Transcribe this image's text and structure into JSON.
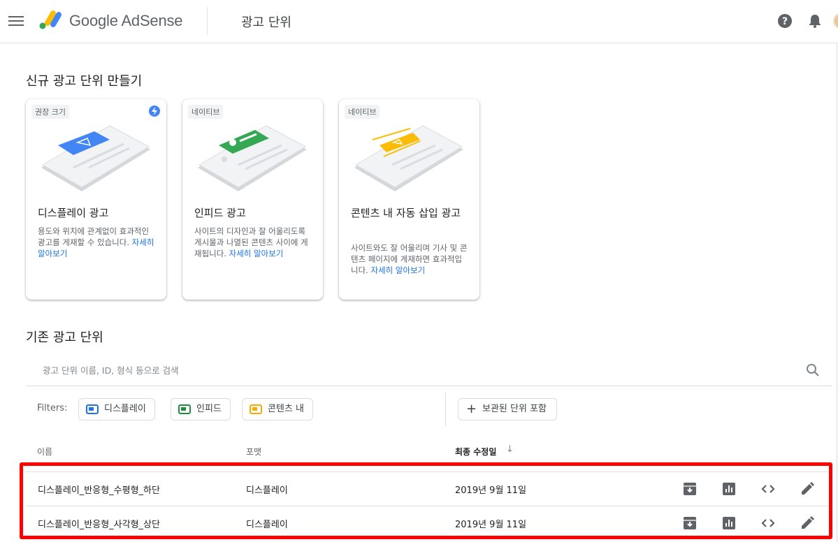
{
  "header": {
    "brand": "Google AdSense",
    "page_title": "광고 단위"
  },
  "create_section": {
    "title": "신규 광고 단위 만들기",
    "cards": [
      {
        "chip": "권장 크기",
        "title": "디스플레이 광고",
        "desc": "용도와 위치에 관계없이 효과적인 광고를 게재할 수 있습니다.",
        "link": "자세히 알아보기",
        "color": "#4285f4"
      },
      {
        "chip": "네이티브",
        "title": "인피드 광고",
        "desc": "사이트의 디자인과 잘 어울리도록 게시물과 나열된 콘텐츠 사이에 게재됩니다.",
        "link": "자세히 알아보기",
        "color": "#34a853"
      },
      {
        "chip": "네이티브",
        "title": "콘텐츠 내 자동 삽입 광고",
        "desc": "사이트와도 잘 어울리며 기사 및 콘텐츠 페이지에 게재하면 효과적입니다.",
        "link": "자세히 알아보기",
        "color": "#fbbc04"
      }
    ]
  },
  "existing_section": {
    "title": "기존 광고 단위",
    "search_placeholder": "광고 단위 이름, ID, 형식 등으로 검색",
    "filters_label": "Filters:",
    "filters": [
      {
        "label": "디스플레이",
        "color": "#1a73e8"
      },
      {
        "label": "인피드",
        "color": "#1e8e3e"
      },
      {
        "label": "콘텐츠 내",
        "color": "#f9ab00"
      }
    ],
    "include_archived": "보관된 단위 포함",
    "columns": {
      "name": "이름",
      "format": "포맷",
      "modified": "최종 수정일",
      "sort_arrow": "↓"
    },
    "rows": [
      {
        "name": "디스플레이_반응형_수평형_하단",
        "format": "디스플레이",
        "modified": "2019년 9월 11일"
      },
      {
        "name": "디스플레이_반응형_사각형_상단",
        "format": "디스플레이",
        "modified": "2019년 9월 11일"
      }
    ]
  }
}
